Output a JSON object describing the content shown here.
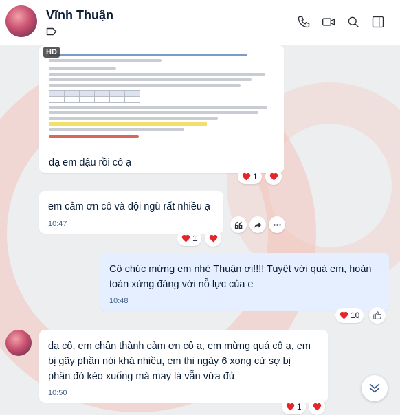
{
  "header": {
    "contact_name": "Vĩnh Thuận",
    "icons": [
      "phone-icon",
      "video-call-icon",
      "search-icon",
      "sidebar-toggle-icon",
      "label-tag-icon"
    ]
  },
  "messages": [
    {
      "id": "m1",
      "sender": "other",
      "type": "image",
      "badge": "HD",
      "caption": "dạ em đậu rồi cô ạ",
      "reactions": {
        "emoji": "heart",
        "count": "1"
      }
    },
    {
      "id": "m2",
      "sender": "other",
      "text": "em cảm ơn cô và đội ngũ rất nhiều ạ",
      "time": "10:47",
      "reactions": {
        "emoji": "heart",
        "count": "1"
      }
    },
    {
      "id": "m3",
      "sender": "me",
      "text_line1": "Cô chúc mừng em nhé Thuận ơi!!!! Tuyệt vời quá em, hoàn",
      "text_line2": "toàn xứng đáng với nỗ lực của e",
      "time": "10:48",
      "reactions": {
        "emoji": "heart",
        "count": "10"
      }
    },
    {
      "id": "m4",
      "sender": "other",
      "text_line1": "dạ cô, em chân thành cảm ơn cô ạ, em mừng quá cô ạ, em",
      "text_line2": "bị gãy phần nói khá nhiều, em thi ngày 6 xong cứ sợ bị",
      "text_line3": "phần đó kéo xuống mà may là vẫn vừa đủ",
      "time": "10:50",
      "reactions": {
        "emoji": "heart",
        "count": "1"
      }
    }
  ],
  "colors": {
    "heart": "#e4262c",
    "my_bubble": "#e5efff",
    "other_bubble": "#ffffff"
  }
}
